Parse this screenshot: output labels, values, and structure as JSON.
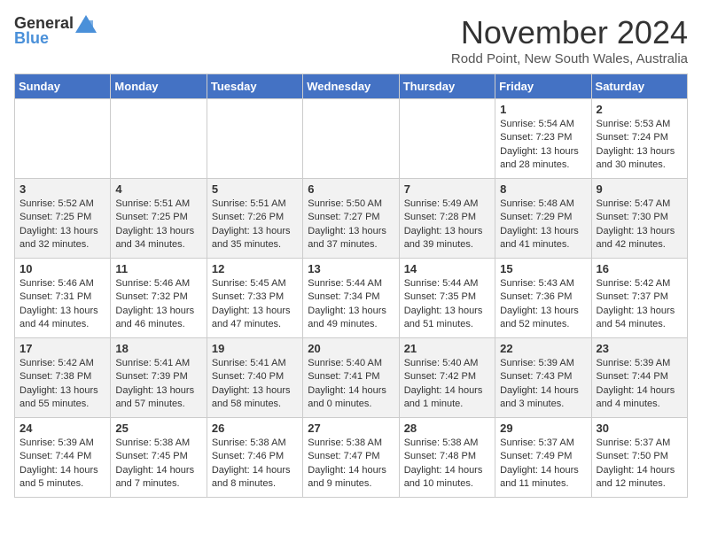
{
  "logo": {
    "general": "General",
    "blue": "Blue"
  },
  "title": "November 2024",
  "location": "Rodd Point, New South Wales, Australia",
  "weekdays": [
    "Sunday",
    "Monday",
    "Tuesday",
    "Wednesday",
    "Thursday",
    "Friday",
    "Saturday"
  ],
  "weeks": [
    [
      {
        "day": "",
        "content": ""
      },
      {
        "day": "",
        "content": ""
      },
      {
        "day": "",
        "content": ""
      },
      {
        "day": "",
        "content": ""
      },
      {
        "day": "",
        "content": ""
      },
      {
        "day": "1",
        "content": "Sunrise: 5:54 AM\nSunset: 7:23 PM\nDaylight: 13 hours and 28 minutes."
      },
      {
        "day": "2",
        "content": "Sunrise: 5:53 AM\nSunset: 7:24 PM\nDaylight: 13 hours and 30 minutes."
      }
    ],
    [
      {
        "day": "3",
        "content": "Sunrise: 5:52 AM\nSunset: 7:25 PM\nDaylight: 13 hours and 32 minutes."
      },
      {
        "day": "4",
        "content": "Sunrise: 5:51 AM\nSunset: 7:25 PM\nDaylight: 13 hours and 34 minutes."
      },
      {
        "day": "5",
        "content": "Sunrise: 5:51 AM\nSunset: 7:26 PM\nDaylight: 13 hours and 35 minutes."
      },
      {
        "day": "6",
        "content": "Sunrise: 5:50 AM\nSunset: 7:27 PM\nDaylight: 13 hours and 37 minutes."
      },
      {
        "day": "7",
        "content": "Sunrise: 5:49 AM\nSunset: 7:28 PM\nDaylight: 13 hours and 39 minutes."
      },
      {
        "day": "8",
        "content": "Sunrise: 5:48 AM\nSunset: 7:29 PM\nDaylight: 13 hours and 41 minutes."
      },
      {
        "day": "9",
        "content": "Sunrise: 5:47 AM\nSunset: 7:30 PM\nDaylight: 13 hours and 42 minutes."
      }
    ],
    [
      {
        "day": "10",
        "content": "Sunrise: 5:46 AM\nSunset: 7:31 PM\nDaylight: 13 hours and 44 minutes."
      },
      {
        "day": "11",
        "content": "Sunrise: 5:46 AM\nSunset: 7:32 PM\nDaylight: 13 hours and 46 minutes."
      },
      {
        "day": "12",
        "content": "Sunrise: 5:45 AM\nSunset: 7:33 PM\nDaylight: 13 hours and 47 minutes."
      },
      {
        "day": "13",
        "content": "Sunrise: 5:44 AM\nSunset: 7:34 PM\nDaylight: 13 hours and 49 minutes."
      },
      {
        "day": "14",
        "content": "Sunrise: 5:44 AM\nSunset: 7:35 PM\nDaylight: 13 hours and 51 minutes."
      },
      {
        "day": "15",
        "content": "Sunrise: 5:43 AM\nSunset: 7:36 PM\nDaylight: 13 hours and 52 minutes."
      },
      {
        "day": "16",
        "content": "Sunrise: 5:42 AM\nSunset: 7:37 PM\nDaylight: 13 hours and 54 minutes."
      }
    ],
    [
      {
        "day": "17",
        "content": "Sunrise: 5:42 AM\nSunset: 7:38 PM\nDaylight: 13 hours and 55 minutes."
      },
      {
        "day": "18",
        "content": "Sunrise: 5:41 AM\nSunset: 7:39 PM\nDaylight: 13 hours and 57 minutes."
      },
      {
        "day": "19",
        "content": "Sunrise: 5:41 AM\nSunset: 7:40 PM\nDaylight: 13 hours and 58 minutes."
      },
      {
        "day": "20",
        "content": "Sunrise: 5:40 AM\nSunset: 7:41 PM\nDaylight: 14 hours and 0 minutes."
      },
      {
        "day": "21",
        "content": "Sunrise: 5:40 AM\nSunset: 7:42 PM\nDaylight: 14 hours and 1 minute."
      },
      {
        "day": "22",
        "content": "Sunrise: 5:39 AM\nSunset: 7:43 PM\nDaylight: 14 hours and 3 minutes."
      },
      {
        "day": "23",
        "content": "Sunrise: 5:39 AM\nSunset: 7:44 PM\nDaylight: 14 hours and 4 minutes."
      }
    ],
    [
      {
        "day": "24",
        "content": "Sunrise: 5:39 AM\nSunset: 7:44 PM\nDaylight: 14 hours and 5 minutes."
      },
      {
        "day": "25",
        "content": "Sunrise: 5:38 AM\nSunset: 7:45 PM\nDaylight: 14 hours and 7 minutes."
      },
      {
        "day": "26",
        "content": "Sunrise: 5:38 AM\nSunset: 7:46 PM\nDaylight: 14 hours and 8 minutes."
      },
      {
        "day": "27",
        "content": "Sunrise: 5:38 AM\nSunset: 7:47 PM\nDaylight: 14 hours and 9 minutes."
      },
      {
        "day": "28",
        "content": "Sunrise: 5:38 AM\nSunset: 7:48 PM\nDaylight: 14 hours and 10 minutes."
      },
      {
        "day": "29",
        "content": "Sunrise: 5:37 AM\nSunset: 7:49 PM\nDaylight: 14 hours and 11 minutes."
      },
      {
        "day": "30",
        "content": "Sunrise: 5:37 AM\nSunset: 7:50 PM\nDaylight: 14 hours and 12 minutes."
      }
    ]
  ]
}
